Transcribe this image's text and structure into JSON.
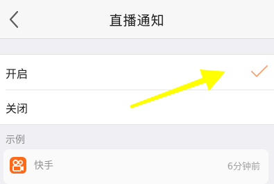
{
  "header": {
    "title": "直播通知",
    "back_icon": "chevron-left-icon"
  },
  "options": [
    {
      "label": "开启",
      "selected": true
    },
    {
      "label": "关闭",
      "selected": false
    }
  ],
  "check_icon": "checkmark-icon",
  "example": {
    "section_label": "示例",
    "app_name": "快手",
    "time": "6分钟前",
    "app_icon": "kuaishou-icon"
  },
  "colors": {
    "accent": "#f5a072",
    "app_icon": "#ff6a1a",
    "annotation": "#ffff00"
  }
}
